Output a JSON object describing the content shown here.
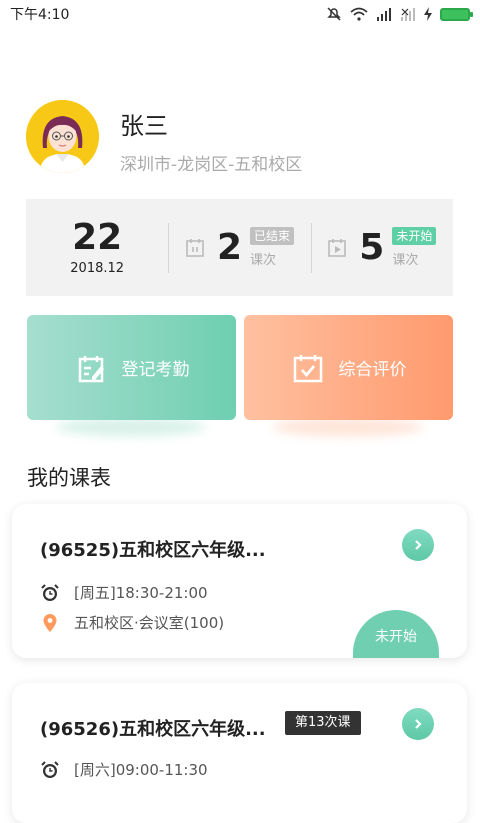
{
  "status_bar": {
    "time": "下午4:10"
  },
  "profile": {
    "name": "张三",
    "school": "深圳市-龙岗区-五和校区"
  },
  "stats": {
    "day": "22",
    "month": "2018.12",
    "finished_count": "2",
    "finished_tag": "已结束",
    "finished_unit": "课次",
    "pending_count": "5",
    "pending_tag": "未开始",
    "pending_unit": "课次"
  },
  "actions": {
    "attendance_label": "登记考勤",
    "evaluation_label": "综合评价"
  },
  "schedule": {
    "section_title": "我的课表",
    "courses": [
      {
        "title": "(96525)五和校区六年级...",
        "time": "[周五]18:30-21:00",
        "location": "五和校区·会议室(100)",
        "status": "未开始"
      },
      {
        "title": "(96526)五和校区六年级...",
        "badge": "第13次课",
        "time": "[周六]09:00-11:30"
      }
    ]
  },
  "colors": {
    "accent_green": "#6fcfb0",
    "accent_orange": "#ff9a6e"
  }
}
